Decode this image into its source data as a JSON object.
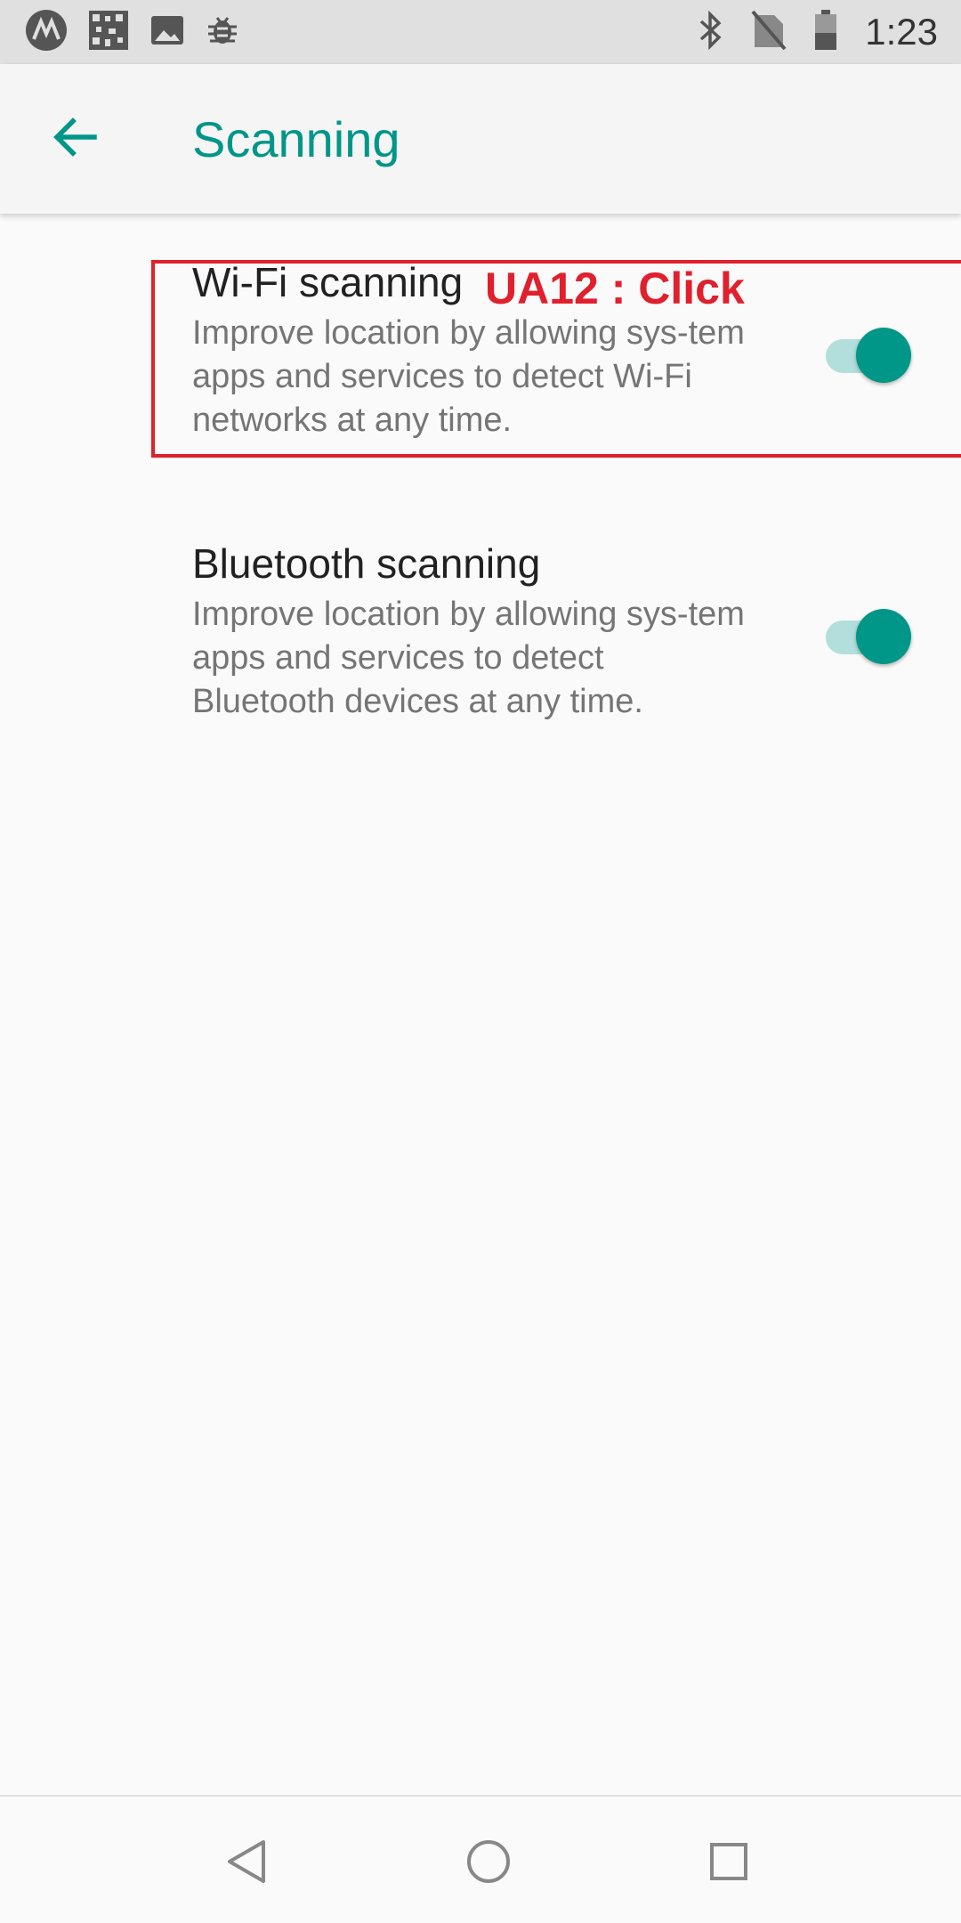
{
  "status_bar": {
    "left_icons": [
      "motorola-icon",
      "qr-icon",
      "image-icon",
      "bug-icon"
    ],
    "right_icons": [
      "bluetooth-icon",
      "no-sim-icon",
      "battery-icon"
    ],
    "time": "1:23"
  },
  "app_bar": {
    "title": "Scanning"
  },
  "preferences": [
    {
      "title": "Wi-Fi scanning",
      "summary": "Improve location by allowing sys-tem apps and services to detect Wi-Fi networks at any time.",
      "enabled": true
    },
    {
      "title": "Bluetooth scanning",
      "summary": "Improve location by allowing sys-tem apps and services to detect Bluetooth devices at any time.",
      "enabled": true
    }
  ],
  "annotation": {
    "label": "UA12 : Click",
    "color": "#e0202c"
  },
  "nav_bar": {
    "buttons": [
      "back-icon",
      "home-icon",
      "recents-icon"
    ]
  },
  "colors": {
    "accent": "#009688",
    "switch_track": "#b2dfdb"
  }
}
